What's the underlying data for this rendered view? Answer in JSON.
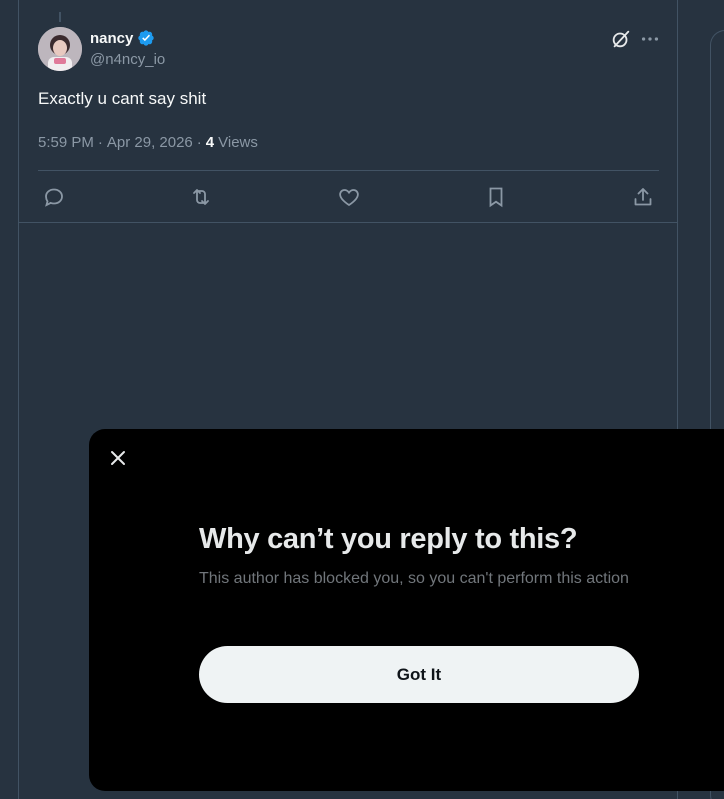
{
  "tweet": {
    "display_name": "nancy",
    "verified": true,
    "handle": "@n4ncy_io",
    "text": "Exactly u cant say shit",
    "time": "5:59 PM",
    "date": "Apr 29, 2026",
    "separator": "·",
    "views_count": "4",
    "views_label": "Views"
  },
  "modal": {
    "title": "Why can’t you reply to this?",
    "body": "This author has blocked you, so you can't perform this action",
    "button_label": "Got It"
  },
  "colors": {
    "background": "#273340",
    "border": "#425364",
    "muted": "#8b98a5",
    "verified": "#1d9bf0",
    "modal_bg": "#000000"
  },
  "icons": [
    "grok-icon",
    "more-icon",
    "reply-icon",
    "retweet-icon",
    "like-icon",
    "bookmark-icon",
    "share-icon",
    "close-icon",
    "verified-badge-icon"
  ]
}
